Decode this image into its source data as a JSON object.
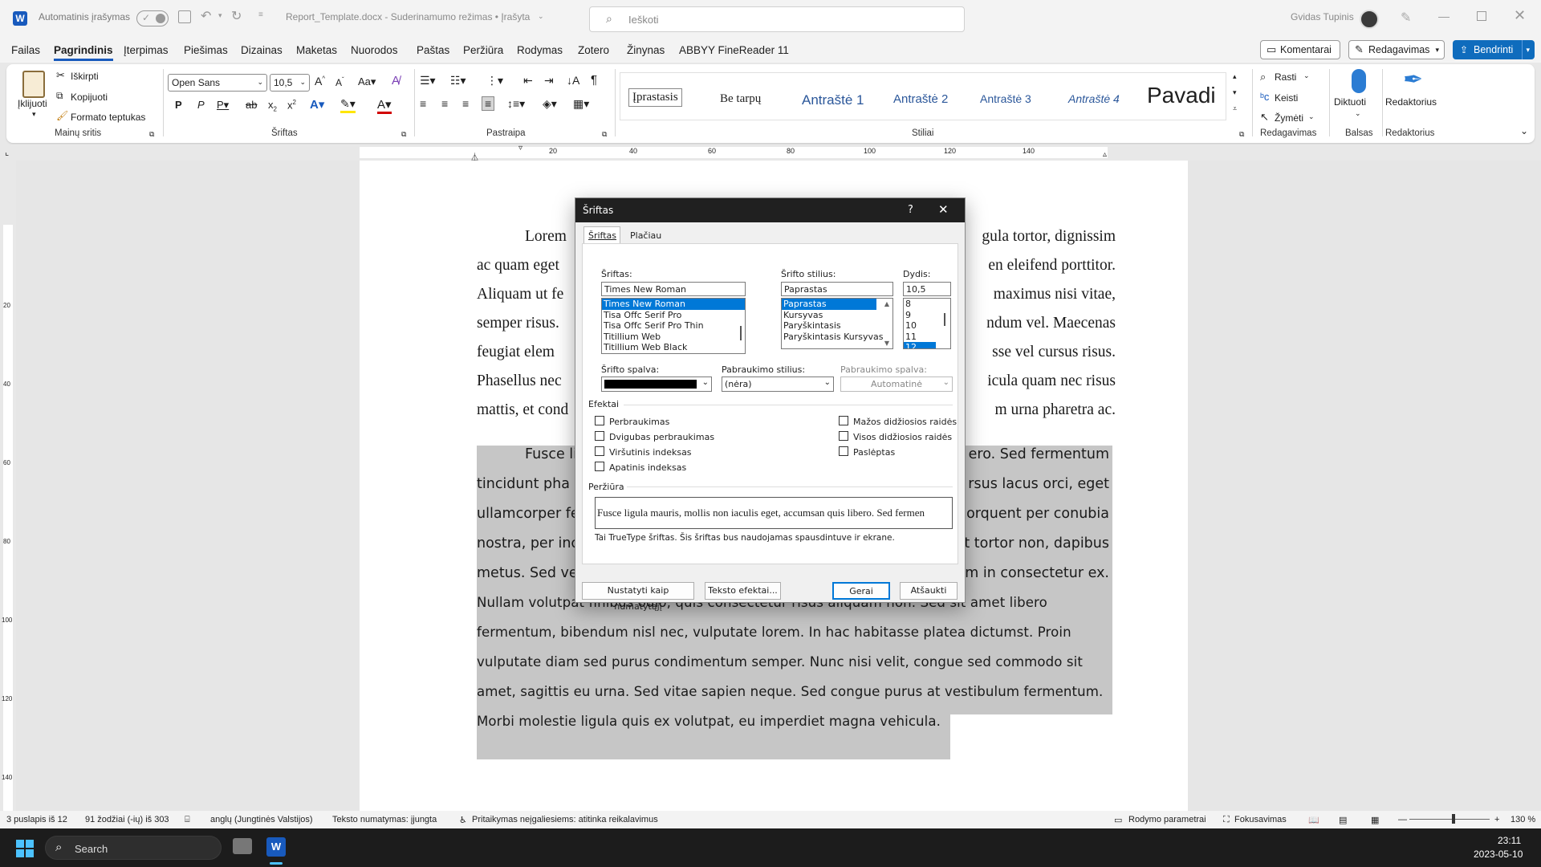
{
  "titlebar": {
    "autosave_label": "Automatinis įrašymas",
    "doc_title": "Report_Template.docx  -  Suderinamumo režimas • Įrašyta",
    "search_placeholder": "Ieškoti",
    "user_name": "Gvidas Tupinis"
  },
  "menu": {
    "items": [
      "Failas",
      "Pagrindinis",
      "Įterpimas",
      "Piešimas",
      "Dizainas",
      "Maketas",
      "Nuorodos",
      "Paštas",
      "Peržiūra",
      "Rodymas",
      "Zotero",
      "Žinynas",
      "ABBYY FineReader 11"
    ],
    "comments_button": "Komentarai",
    "editing_button": "Redagavimas",
    "share_button": "Bendrinti"
  },
  "ribbon": {
    "clipboard": {
      "paste": "Įklijuoti",
      "cut": "Iškirpti",
      "copy": "Kopijuoti",
      "format_painter": "Formato teptukas",
      "label": "Mainų sritis"
    },
    "font": {
      "name": "Open Sans",
      "size": "10,5",
      "label": "Šriftas",
      "bold": "P",
      "italic": "P"
    },
    "paragraph": {
      "label": "Pastraipa"
    },
    "styles": {
      "items": [
        "Įprastasis",
        "Be tarpų",
        "Antraštė 1",
        "Antraštė 2",
        "Antraštė 3",
        "Antraštė 4",
        "Pavadi"
      ],
      "label": "Stiliai"
    },
    "editing": {
      "find": "Rasti",
      "replace": "Keisti",
      "select": "Žymėti",
      "label": "Redagavimas"
    },
    "voice": {
      "dictate": "Diktuoti",
      "label": "Balsas"
    },
    "editor": {
      "name": "Redaktorius",
      "label": "Redaktorius"
    }
  },
  "ruler": {
    "ticks": [
      "20",
      "40",
      "60",
      "80",
      "100",
      "120",
      "140"
    ],
    "vticks": [
      "20",
      "40",
      "60",
      "80",
      "100",
      "120",
      "140"
    ]
  },
  "document": {
    "para1": [
      {
        "left": "Lorem",
        "right": "gula tortor, dignissim"
      },
      {
        "left": "ac quam eget",
        "right": "en eleifend porttitor."
      },
      {
        "left": "Aliquam ut fe",
        "right": "maximus nisi vitae,"
      },
      {
        "left": "semper risus.",
        "right": "ndum vel. Maecenas"
      },
      {
        "left": "feugiat elem",
        "right": "sse vel cursus risus."
      },
      {
        "left": "Phasellus nec",
        "right": "icula quam nec risus"
      },
      {
        "left": "mattis, et cond",
        "right": "m urna pharetra ac."
      }
    ],
    "para2": [
      {
        "left": "Fusce li",
        "right": "ero. Sed fermentum"
      },
      {
        "left": "tincidunt pha",
        "right": "rsus lacus orci, eget"
      },
      {
        "left": "ullamcorper fe",
        "right": "orquent per conubia"
      },
      {
        "left": "nostra, per inc",
        "right": "t tortor non, dapibus"
      },
      {
        "left": "metus. Sed ve",
        "right": "m in consectetur ex."
      },
      {
        "left": "Nullam volutpat finibus odio, quis consectetur risus aliquam non. Sed sit amet libero",
        "right": ""
      }
    ],
    "para2_full": [
      "fermentum, bibendum nisl nec, vulputate lorem. In hac habitasse platea dictumst. Proin",
      "vulputate diam sed purus condimentum semper. Nunc nisi velit, congue sed commodo sit",
      "amet, sagittis eu urna. Sed vitae sapien neque. Sed congue purus at vestibulum fermentum.",
      "Morbi molestie ligula quis ex volutpat, eu imperdiet magna vehicula."
    ]
  },
  "dialog": {
    "title": "Šriftas",
    "help": "?",
    "tabs": [
      "Šriftas",
      "Plačiau"
    ],
    "font_label": "Šriftas:",
    "font_value": "Times New Roman",
    "font_list": [
      "Times New Roman",
      "Tisa Offc Serif Pro",
      "Tisa Offc Serif Pro Thin",
      "Titillium Web",
      "Titillium Web Black"
    ],
    "style_label": "Šrifto stilius:",
    "style_value": "Paprastas",
    "style_list": [
      "Paprastas",
      "Kursyvas",
      "Paryškintasis",
      "Paryškintasis Kursyvas"
    ],
    "size_label": "Dydis:",
    "size_value": "10,5",
    "size_list": [
      "8",
      "9",
      "10",
      "11",
      "12"
    ],
    "color_label": "Šrifto spalva:",
    "underline_style_label": "Pabraukimo stilius:",
    "underline_style_value": "(nėra)",
    "underline_color_label": "Pabraukimo spalva:",
    "underline_color_value": "Automatinė",
    "effects_label": "Efektai",
    "effects_left": [
      "Perbraukimas",
      "Dvigubas perbraukimas",
      "Viršutinis indeksas",
      "Apatinis indeksas"
    ],
    "effects_right": [
      "Mažos didžiosios raidės",
      "Visos didžiosios raidės",
      "Paslėptas"
    ],
    "preview_label": "Peržiūra",
    "preview_text": "Fusce ligula mauris, mollis non iaculis eget, accumsan quis libero. Sed fermen",
    "preview_note": "Tai TrueType šriftas. Šis šriftas bus naudojamas spausdintuve ir ekrane.",
    "set_default": "Nustatyti kaip numatytąjį",
    "text_effects": "Teksto efektai...",
    "ok": "Gerai",
    "cancel": "Atšaukti"
  },
  "status": {
    "page": "3 puslapis iš 12",
    "words": "91 žodžiai (-ių) iš 303",
    "language": "anglų (Jungtinės Valstijos)",
    "prediction": "Teksto numatymas: įjungta",
    "accessibility": "Pritaikymas neįgaliesiems: atitinka reikalavimus",
    "display_settings": "Rodymo parametrai",
    "focus": "Fokusavimas",
    "zoom": "130 %"
  },
  "taskbar": {
    "search": "Search",
    "time": "23:11",
    "date": "2023-05-10"
  },
  "colors": {
    "accent": "#185abd",
    "share": "#0f6cbd",
    "selection": "#c6c6c6",
    "dialog_title": "#202020"
  }
}
